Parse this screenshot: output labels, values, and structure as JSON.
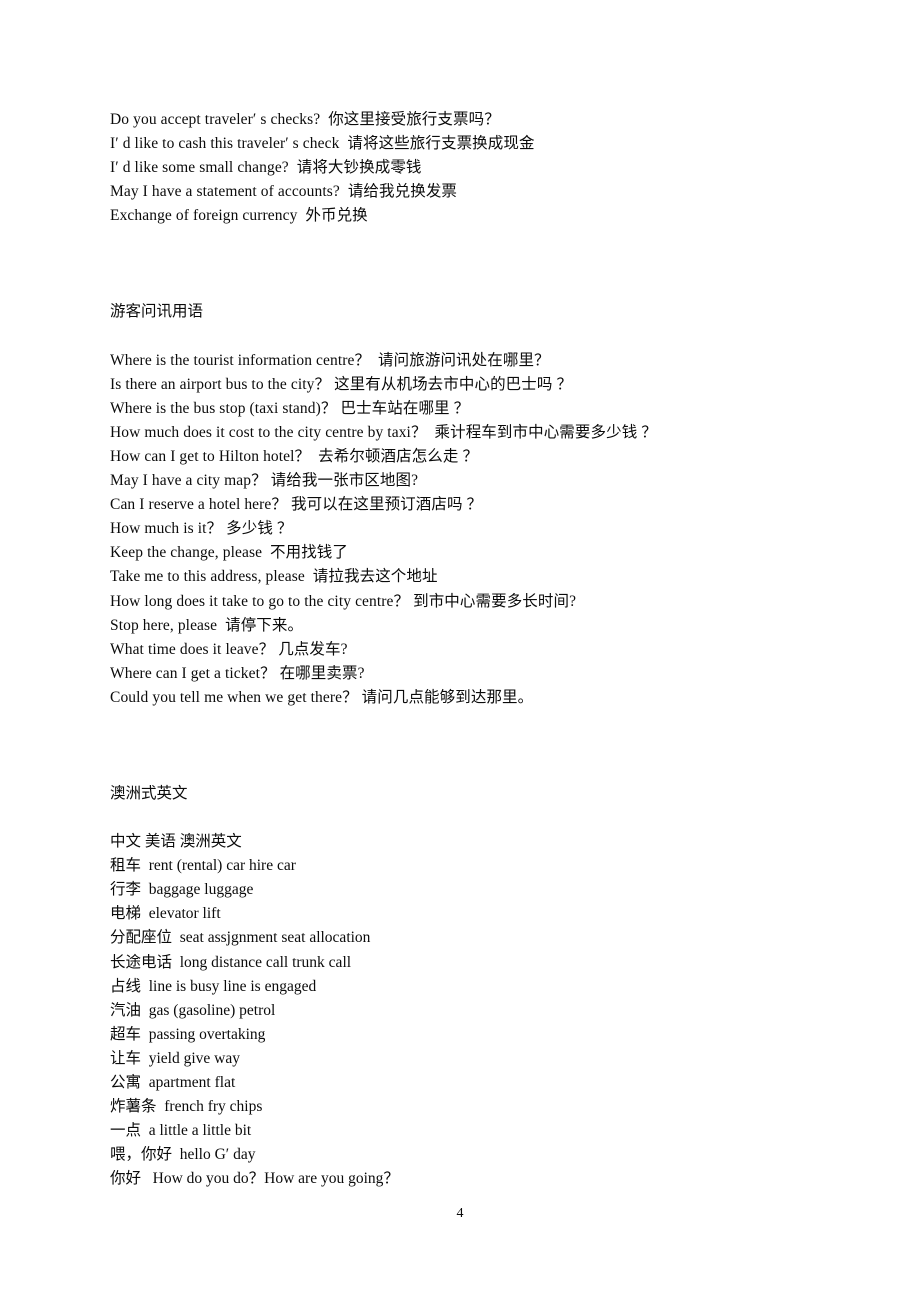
{
  "document": {
    "page_number": "4",
    "sections": [
      {
        "id": "currency-exchange",
        "heading": "",
        "lines": [
          "Do you accept traveler′ s checks?  你这里接受旅行支票吗？",
          "I′ d like to cash this traveler′ s check  请将这些旅行支票换成现金",
          "I′ d like some small change?  请将大钞换成零钱",
          "May I have a statement of accounts?  请给我兑换发票",
          "Exchange of foreign currency  外币兑换"
        ]
      },
      {
        "id": "tourist-information",
        "heading": "游客问讯用语",
        "lines": [
          "Where is the tourist information centre？  请问旅游问讯处在哪里？",
          "Is there an airport bus to the city？ 这里有从机场去市中心的巴士吗 ？",
          "Where is the bus stop (taxi stand)？ 巴士车站在哪里 ？",
          "How much does it cost to the city centre by taxi？  乘计程车到市中心需要多少钱 ？",
          "How can I get to Hilton hotel？  去希尔顿酒店怎么走 ？",
          "May I have a city map？ 请给我一张市区地图?",
          "Can I reserve a hotel here？ 我可以在这里预订酒店吗 ？",
          "How much is it？ 多少钱 ？",
          "Keep the change, please  不用找钱了",
          "Take me to this address, please  请拉我去这个地址",
          "How long does it take to go to the city centre？ 到市中心需要多长时间?",
          "Stop here, please  请停下来。",
          "What time does it leave？ 几点发车?",
          "Where can I get a ticket？ 在哪里卖票?",
          "Could you tell me when we get there？ 请问几点能够到达那里。"
        ]
      },
      {
        "id": "australian-english",
        "heading": "澳洲式英文",
        "lines": [
          "中文 美语 澳洲英文",
          "租车  rent (rental) car hire car",
          "行李  baggage luggage",
          "电梯  elevator lift",
          "分配座位  seat assjgnment seat allocation",
          "长途电话  long distance call trunk call",
          "占线  line is busy line is engaged",
          "汽油  gas (gasoline) petrol",
          "超车  passing overtaking",
          "让车  yield give way",
          "公寓  apartment flat",
          "炸薯条  french fry chips",
          "一点  a little a little bit",
          "喂，你好  hello G′ day",
          "你好   How do you do？How are you going？"
        ]
      }
    ]
  }
}
